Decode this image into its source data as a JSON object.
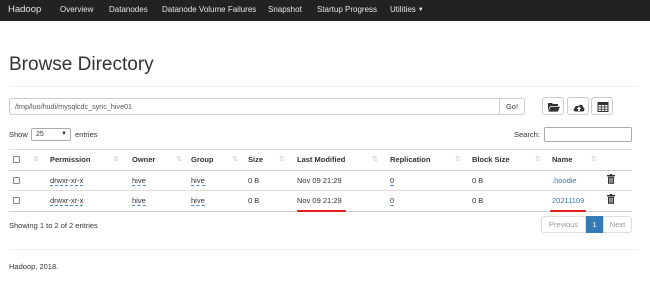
{
  "navbar": {
    "brand": "Hadoop",
    "items": [
      "Overview",
      "Datanodes",
      "Datanode Volume Failures",
      "Snapshot",
      "Startup Progress",
      "Utilities"
    ]
  },
  "page": {
    "title": "Browse Directory"
  },
  "toolbar": {
    "path_value": "/tmp/luo/hudi/mysqlcdc_sync_hive01",
    "go_label": "Go!",
    "icons": [
      "folder-open-icon",
      "upload-icon",
      "table-icon"
    ]
  },
  "controls": {
    "show_label": "Show",
    "page_size": "25",
    "entries_label": "entries",
    "search_label": "Search:",
    "search_value": ""
  },
  "table": {
    "columns": [
      "Permission",
      "Owner",
      "Group",
      "Size",
      "Last Modified",
      "Replication",
      "Block Size",
      "Name"
    ],
    "rows": [
      {
        "permission": "drwxr-xr-x",
        "owner": "hive",
        "group": "hive",
        "size": "0 B",
        "last_modified": "Nov 09 21:29",
        "replication": "0",
        "block_size": "0 B",
        "name": ".hoodie"
      },
      {
        "permission": "drwxr-xr-x",
        "owner": "hive",
        "group": "hive",
        "size": "0 B",
        "last_modified": "Nov 09 21:29",
        "replication": "0",
        "block_size": "0 B",
        "name": "20211109"
      }
    ]
  },
  "info": "Showing 1 to 2 of 2 entries",
  "pagination": {
    "previous": "Previous",
    "current": "1",
    "next": "Next"
  },
  "footer": "Hadoop, 2018.",
  "colors": {
    "navbar": "#222222",
    "link": "#337ab7",
    "annotation": "#e01f1f"
  }
}
